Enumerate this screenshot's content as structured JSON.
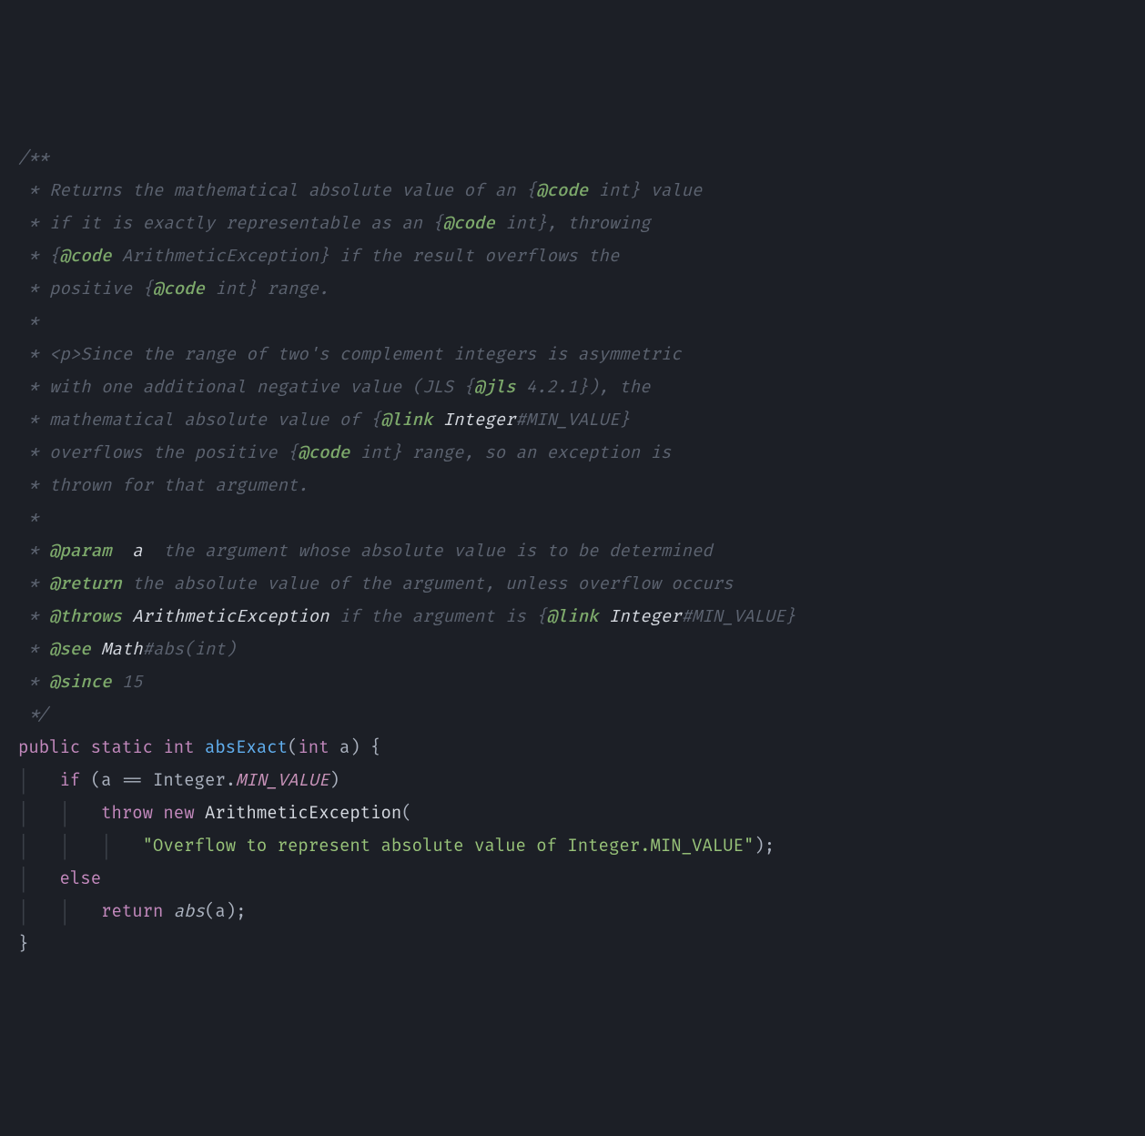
{
  "doc": {
    "open": "/**",
    "star": " * ",
    "blank": " *",
    "close": " */",
    "d1a": "Returns the mathematical absolute value of an {",
    "tag_code1": "@code",
    "d1b": " int} value",
    "d2a": "if it is exactly representable as an {",
    "tag_code2": "@code",
    "d2b": " int}, throwing",
    "d3a": "{",
    "tag_code3": "@code",
    "d3b": " ArithmeticException} if the result overflows the",
    "d4a": "positive {",
    "tag_code4": "@code",
    "d4b": " int} range.",
    "d5a": "<p>",
    "d5b": "Since the range of two's complement integers is asymmetric",
    "d6a": "with one additional negative value (JLS {",
    "tag_jls": "@jls",
    "d6b": " 4.2.1}), the",
    "d7a": "mathematical absolute value of {",
    "tag_link1": "@link",
    "link1_class": " Integer",
    "link1_frag": "#MIN_VALUE}",
    "d8a": "overflows the positive {",
    "tag_code5": "@code",
    "d8b": " int} range, so an exception is",
    "d9": "thrown for that argument.",
    "tag_param": "@param",
    "param_name": "  a  ",
    "param_desc": "the argument whose absolute value is to be determined",
    "tag_return": "@return",
    "return_desc": " the absolute value of the argument, unless overflow occurs",
    "tag_throws": "@throws",
    "throws_class": " ArithmeticException ",
    "throws_desc_a": "if the argument is {",
    "tag_link2": "@link",
    "link2_class": " Integer",
    "link2_frag": "#MIN_VALUE}",
    "tag_see": "@see",
    "see_class": " Math",
    "see_frag": "#abs(int)",
    "tag_since": "@since",
    "since_val": " 15"
  },
  "code": {
    "kw_public": "public",
    "kw_static": "static",
    "kw_int": "int",
    "fn_name": "absExact",
    "paren_open": "(",
    "param_type": "int",
    "param_name": " a",
    "paren_close": ")",
    "brace_open": " {",
    "kw_if": "if",
    "if_cond_a": " (a == Integer.",
    "min_value": "MIN_VALUE",
    "if_cond_b": ")",
    "kw_throw": "throw",
    "kw_new": "new",
    "exc_class": " ArithmeticException",
    "exc_open": "(",
    "exc_msg": "\"Overflow to represent absolute value of Integer.MIN_VALUE\"",
    "exc_close": ");",
    "kw_else": "else",
    "kw_return": "return",
    "call_abs": "abs",
    "call_args": "(a);",
    "brace_close": "}",
    "indent4": "    ",
    "indent8": "        ",
    "indent12": "            ",
    "sp": " ",
    "guide": "│"
  }
}
